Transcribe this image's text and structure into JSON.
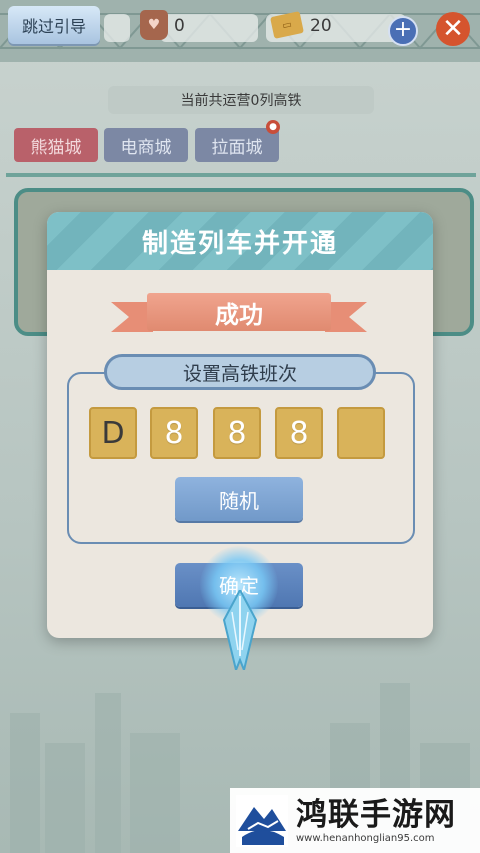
{
  "topbar": {
    "skip_label": "跳过引导",
    "hearts_value": "0",
    "tickets_value": "20",
    "heart_icon": "heart-badge-icon",
    "ticket_icon": "ticket-icon",
    "plus_icon": "plus-icon",
    "close_icon": "close-icon"
  },
  "status": {
    "text": "当前共运营0列高铁"
  },
  "city_tabs": [
    {
      "label": "熊猫城",
      "active": true
    },
    {
      "label": "电商城",
      "active": false
    },
    {
      "label": "拉面城",
      "active": false,
      "locked": true
    }
  ],
  "dialog": {
    "title": "制造列车并开通",
    "result": "成功",
    "group_label": "设置高铁班次",
    "code_digits": [
      "D",
      "8",
      "8",
      "8",
      ""
    ],
    "random_label": "随机",
    "confirm_label": "确定"
  },
  "watermark": {
    "title": "鸿联手游网",
    "url": "www.henanhonglian95.com"
  },
  "colors": {
    "accent_teal": "#7ec0c7",
    "ribbon": "#e78e76",
    "digit_tile": "#d9b35a",
    "button_blue": "#7199c9"
  }
}
